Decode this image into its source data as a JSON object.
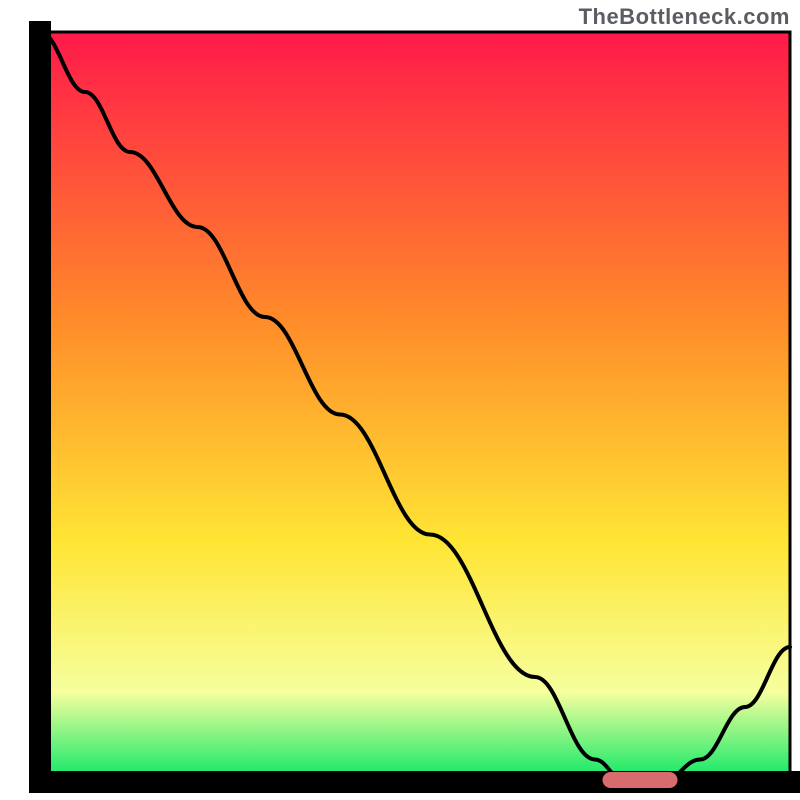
{
  "watermark": "TheBottleneck.com",
  "colors": {
    "gradient_top": "#ff1a4a",
    "gradient_mid1": "#ff8a2a",
    "gradient_mid2": "#ffe534",
    "gradient_mid3": "#f6ff9e",
    "gradient_bottom": "#08e765",
    "axis": "#000000",
    "curve": "#000000",
    "marker": "#d86b6d"
  },
  "chart_data": {
    "type": "line",
    "x": [
      0.0,
      0.06,
      0.12,
      0.21,
      0.3,
      0.4,
      0.52,
      0.66,
      0.74,
      0.78,
      0.83,
      0.88,
      0.94,
      1.0
    ],
    "y": [
      1.0,
      0.92,
      0.84,
      0.74,
      0.62,
      0.49,
      0.33,
      0.14,
      0.03,
      0.0,
      0.0,
      0.03,
      0.1,
      0.18
    ],
    "xlim": [
      0,
      1
    ],
    "ylim": [
      0,
      1
    ],
    "title": "",
    "xlabel": "",
    "ylabel": "",
    "marker": {
      "x": 0.8,
      "width": 0.1,
      "y": 0.0
    }
  }
}
